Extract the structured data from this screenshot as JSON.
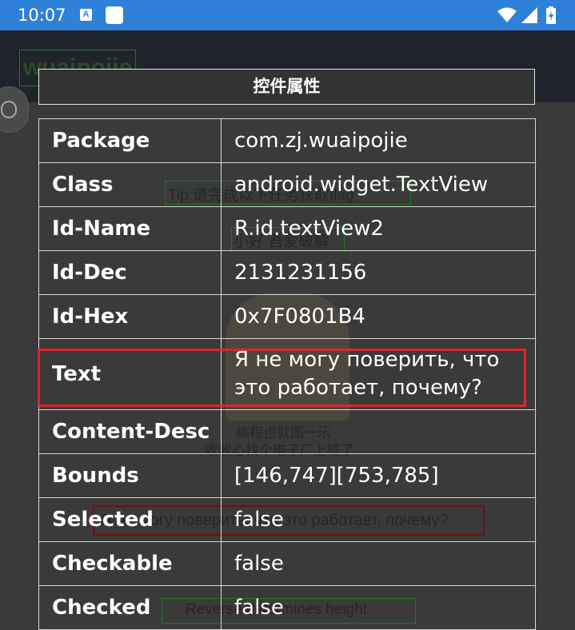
{
  "status_bar": {
    "time": "10:07",
    "a_badge": "A"
  },
  "app": {
    "title": "wuaipojie"
  },
  "background": {
    "tip": "Tip:请完成以下任务获取flag",
    "line2": "小好 吾爱破解",
    "caption1": "编程也就图一乐",
    "caption2": "收收心找个电子厂上班了",
    "hint": "Я не могу поверить, что это работает, почему?",
    "button": "Reverse determines height"
  },
  "dialog": {
    "title": "控件属性",
    "rows": [
      {
        "key": "Package",
        "value": "com.zj.wuaipojie"
      },
      {
        "key": "Class",
        "value": "android.widget.TextView"
      },
      {
        "key": "Id-Name",
        "value": "R.id.textView2"
      },
      {
        "key": "Id-Dec",
        "value": "2131231156"
      },
      {
        "key": "Id-Hex",
        "value": "0x7F0801B4"
      },
      {
        "key": "Text",
        "value": "Я не могу поверить, что это работает, почему?"
      },
      {
        "key": "Content-Desc",
        "value": ""
      },
      {
        "key": "Bounds",
        "value": "[146,747][753,785]"
      },
      {
        "key": "Selected",
        "value": "false"
      },
      {
        "key": "Checkable",
        "value": "false"
      },
      {
        "key": "Checked",
        "value": "false"
      }
    ]
  },
  "colors": {
    "status_bar": "#2f80d8",
    "highlight": "#e0242f"
  }
}
